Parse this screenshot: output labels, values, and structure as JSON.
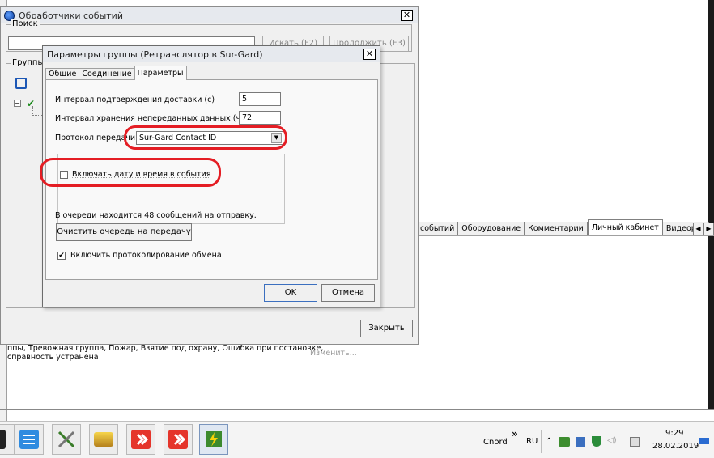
{
  "outer_window": {
    "title": "Обработчики событий",
    "search_legend": "Поиск",
    "find_label": "Искать (F2)",
    "find_next_label": "Продолжить (F3)",
    "groups_legend": "Группы",
    "close_label": "Закрыть"
  },
  "dialog": {
    "title": "Параметры группы (Ретранслятор в Sur-Gard)",
    "tabs": [
      "Общие",
      "Соединение",
      "Параметры"
    ],
    "active_tab": "Параметры",
    "fields": {
      "confirm_interval_label": "Интервал подтверждения доставки (с)",
      "confirm_interval_value": "5",
      "storage_interval_label": "Интервал хранения непереданных данных (ч)",
      "storage_interval_value": "72",
      "protocol_label": "Протокол передачи",
      "protocol_value": "Sur-Gard Contact ID",
      "include_datetime_label": "Включать дату и время в события",
      "include_datetime_checked": false,
      "queue_info": "В очереди находится 48 сообщений на отправку.",
      "clear_queue_label": "Очистить очередь на передачу",
      "logging_label": "Включить протоколирование обмена",
      "logging_checked": true
    },
    "ok_label": "OK",
    "cancel_label": "Отмена",
    "highlight_color": "#e41d24"
  },
  "background_app": {
    "tabs": [
      "событий",
      "Оборудование",
      "Комментарии",
      "Личный кабинет",
      "Видеорсу"
    ],
    "active_tab": "Личный кабинет",
    "desc_line1": "ппы, Тревожная группа, Пожар, Взятие под охрану, Ошибка при постановке,",
    "desc_line2": "справность устранена",
    "change_link": "Изменить..."
  },
  "taskbar": {
    "search_text": "Cnord",
    "language": "RU",
    "time": "9:29",
    "date": "28.02.2019",
    "overflow_glyph": "»"
  }
}
